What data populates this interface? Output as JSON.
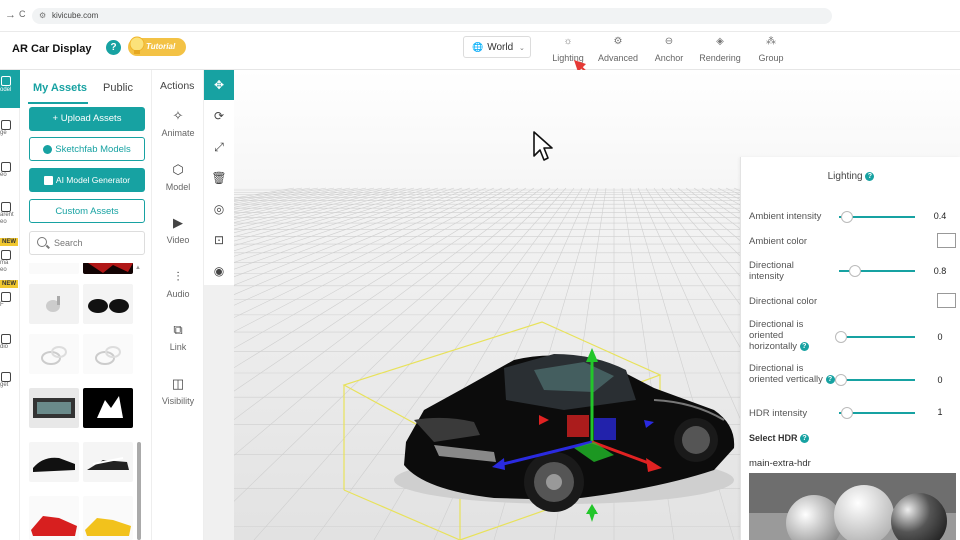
{
  "browser": {
    "url": "kivicube.com",
    "back": "→",
    "reload": "C"
  },
  "header": {
    "app_title": "AR Car Display",
    "help": "?",
    "tutorial_label": "Tutorial",
    "world_label": "World",
    "tools": [
      {
        "label": "Lighting",
        "icon": "sun-icon"
      },
      {
        "label": "Advanced",
        "icon": "gear-icon"
      },
      {
        "label": "Anchor",
        "icon": "anchor-icon"
      },
      {
        "label": "Rendering",
        "icon": "paint-bucket-icon"
      },
      {
        "label": "Group",
        "icon": "group-icon"
      }
    ]
  },
  "rail": {
    "items": [
      "odel",
      "ge",
      "eo",
      "arent\neo",
      "ma\neo",
      "F",
      "dio",
      "get"
    ],
    "new_tag": "NEW"
  },
  "assets": {
    "tab_my": "My Assets",
    "tab_public": "Public",
    "upload": "+ Upload Assets",
    "sketchfab": "Sketchfab Models",
    "ai_generator": "AI Model Generator",
    "custom": "Custom Assets",
    "search_placeholder": "Search"
  },
  "actions": {
    "title": "Actions",
    "items": [
      "Animate",
      "Model",
      "Video",
      "Audio",
      "Link",
      "Visibility"
    ]
  },
  "lighting": {
    "title": "Lighting",
    "ambient_intensity_label": "Ambient intensity",
    "ambient_intensity": "0.4",
    "ambient_color_label": "Ambient color",
    "directional_intensity_label": "Directional intensity",
    "directional_intensity": "0.8",
    "directional_color_label": "Directional color",
    "dir_horizontal_label": "Directional is oriented horizontally",
    "dir_horizontal": "0",
    "dir_vertical_label": "Directional is oriented vertically",
    "dir_vertical": "0",
    "hdr_intensity_label": "HDR intensity",
    "hdr_intensity": "1",
    "select_hdr_label": "Select HDR",
    "hdr_name": "main-extra-hdr"
  },
  "colors": {
    "accent": "#17a2a2",
    "tutorial": "#f3c245",
    "arrow": "#e53935"
  }
}
